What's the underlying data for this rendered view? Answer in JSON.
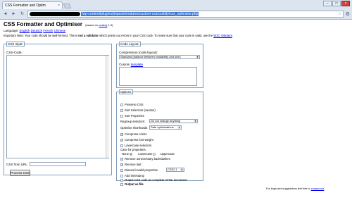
{
  "browser": {
    "tab_title": "CSS Formatter and Optim",
    "tab_close": "×",
    "url_path": "/wp-content/plugins/jetpack/modules/custom-css/csstidy/css_optimiser.php",
    "back_icon": "◄",
    "forward_icon": "►",
    "reload_icon": "↻",
    "star_icon": "☆",
    "wrench_icon": "🔧",
    "minimize": "–",
    "maximize": "□",
    "close": "×"
  },
  "page": {
    "title": "CSS Formatter and Optimiser",
    "based_prefix": "(based on ",
    "based_link": "csstidy",
    "based_suffix": " 1.3)",
    "language_label": "Language:",
    "languages": [
      "English",
      "Deutsch",
      "French",
      "Chinese"
    ],
    "note_prefix": "Important Note: Your code should be well-formed. This is ",
    "note_bold": "not a validator",
    "note_mid": " which points out errors in your CSS code. To make sure that your code is valid, use the ",
    "note_link": "W3C Validator",
    "note_end": "."
  },
  "input": {
    "legend": "CSS Input:",
    "code_label": "CSS-Code:",
    "url_label": "CSS from URL:",
    "url_value": "",
    "process_button": "Process CSS"
  },
  "layout": {
    "legend": "Code Layout:",
    "compression_label": "Compression (code layout):",
    "compression_value": "Standard (balance between readability and size)",
    "custom_prefix": "Custom ",
    "custom_link": "template"
  },
  "options": {
    "legend": "Options",
    "preserve_css": "Preserve CSS",
    "sort_selectors": "Sort Selectors (caution)",
    "sort_properties": "Sort Properties",
    "regroup_label": "Regroup selectors:",
    "regroup_value": "Do not change anything",
    "shorthands_label": "Optimise shorthands",
    "shorthands_value": "Safe optimisations",
    "compress_colors": "Compress colors",
    "compress_font_weight": "Compress font-weight",
    "lowercase_selectors": "Lowercase selectors",
    "case_label": "Case for properties:",
    "case_none": "None",
    "case_lower": "Lowercase",
    "case_upper": "Uppercase",
    "remove_backslashes": "Remove unnecessary backslashes",
    "remove_last": "Remove last ;",
    "discard_invalid": "Discard invalid properties",
    "css_level": "CSS2.1",
    "add_timestamp": "Add timestamp",
    "output_html": "Output CSS code as complete HTML document",
    "output_file": "Output as file",
    "checked_mark": "✓"
  },
  "footer": {
    "text_prefix": "For bugs and suggestions feel free to ",
    "text_link": "contact me",
    "text_end": "."
  }
}
